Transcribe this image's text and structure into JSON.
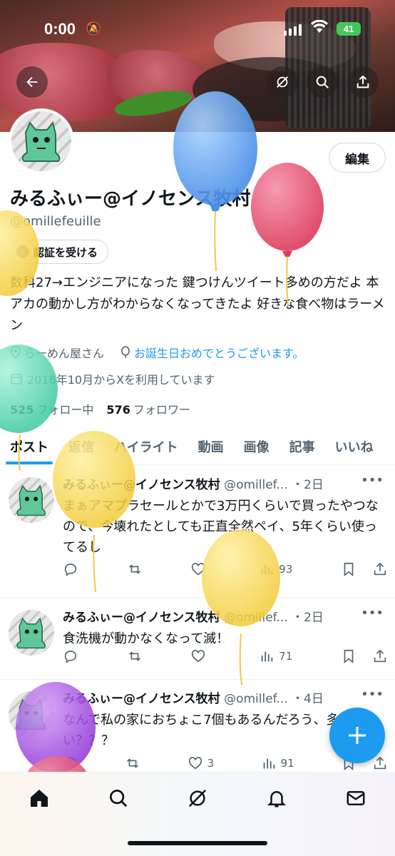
{
  "status_bar": {
    "time": "0:00",
    "battery": "41"
  },
  "profile": {
    "name": "みるふぃー@イノセンス牧村",
    "handle": "@omillefeuille",
    "edit_label": "編集",
    "verify_label": "認証を受ける",
    "bio": "数科27→エンジニアになった 鍵つけんツイート多めの方だよ 本アカの動かし方がわからなくなってきたよ 好きな食べ物はラーメン",
    "location": "らーめん屋さん",
    "birthday_text": "お誕生日おめでとうございます。",
    "joined": "2016年10月からXを利用しています",
    "following_count": "525",
    "following_label": "フォロー中",
    "followers_count": "576",
    "followers_label": "フォロワー"
  },
  "tabs": [
    {
      "label": "ポスト"
    },
    {
      "label": "返信"
    },
    {
      "label": "ハイライト"
    },
    {
      "label": "動画"
    },
    {
      "label": "画像"
    },
    {
      "label": "記事"
    },
    {
      "label": "いいね"
    }
  ],
  "posts": [
    {
      "name": "みるふぃー@イノセンス牧村",
      "handle": "@omillef...",
      "time": "・2日",
      "text": "まぁアマプラセールとかで3万円くらいで買ったやつなので、今壊れたとしても正直全然ペイ、5年くらい使ってるし",
      "likes": "",
      "views": "93"
    },
    {
      "name": "みるふぃー@イノセンス牧村",
      "handle": "@omillef...",
      "time": "・2日",
      "text": "食洗機が動かなくなって滅！",
      "likes": "",
      "views": "71"
    },
    {
      "name": "みるふぃー@イノセンス牧村",
      "handle": "@omillef...",
      "time": "・4日",
      "text": "なんで私の家におちょこ7個もあるんだろう、多すぎない？？？",
      "likes": "3",
      "views": "91"
    }
  ],
  "icons": {
    "back": "arrow-left-icon",
    "grok": "grok-icon",
    "search": "search-icon",
    "share": "share-icon",
    "compose": "plus-icon"
  },
  "colors": {
    "accent": "#1d9bf0",
    "text": "#0f1419",
    "muted": "#536471"
  }
}
